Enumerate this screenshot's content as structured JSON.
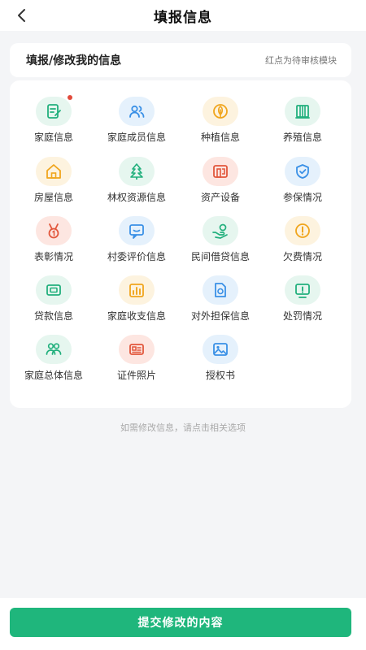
{
  "header": {
    "title": "填报信息",
    "back_icon": "chevron-left-icon"
  },
  "section": {
    "title": "填报/修改我的信息",
    "note": "红点为待审核模块"
  },
  "items": [
    {
      "label": "家庭信息",
      "icon": "edit-document-icon",
      "color": "#22b07d",
      "bg": "#e6f6ef",
      "badge": true
    },
    {
      "label": "家庭成员信息",
      "icon": "users-icon",
      "color": "#3a90e6",
      "bg": "#e5f1fc",
      "badge": false
    },
    {
      "label": "种植信息",
      "icon": "leaf-icon",
      "color": "#f0a51c",
      "bg": "#fdf3df",
      "badge": false
    },
    {
      "label": "养殖信息",
      "icon": "pen-icon",
      "color": "#22b07d",
      "bg": "#e6f6ef",
      "badge": false
    },
    {
      "label": "房屋信息",
      "icon": "house-icon",
      "color": "#f0a51c",
      "bg": "#fdf3df",
      "badge": false
    },
    {
      "label": "林权资源信息",
      "icon": "tree-icon",
      "color": "#22b07d",
      "bg": "#e6f6ef",
      "badge": false
    },
    {
      "label": "资产设备",
      "icon": "asset-icon",
      "color": "#e2573c",
      "bg": "#fde6e1",
      "badge": false
    },
    {
      "label": "参保情况",
      "icon": "shield-icon",
      "color": "#3a90e6",
      "bg": "#e5f1fc",
      "badge": false
    },
    {
      "label": "表彰情况",
      "icon": "medal-icon",
      "color": "#e2573c",
      "bg": "#fde6e1",
      "badge": false
    },
    {
      "label": "村委评价信息",
      "icon": "comment-icon",
      "color": "#3a90e6",
      "bg": "#e5f1fc",
      "badge": false
    },
    {
      "label": "民间借贷信息",
      "icon": "hand-coin-icon",
      "color": "#22b07d",
      "bg": "#e6f6ef",
      "badge": false
    },
    {
      "label": "欠费情况",
      "icon": "alert-circle-icon",
      "color": "#f0a51c",
      "bg": "#fdf3df",
      "badge": false
    },
    {
      "label": "贷款信息",
      "icon": "wallet-icon",
      "color": "#22b07d",
      "bg": "#e6f6ef",
      "badge": false
    },
    {
      "label": "家庭收支信息",
      "icon": "bar-chart-icon",
      "color": "#f0a51c",
      "bg": "#fdf3df",
      "badge": false
    },
    {
      "label": "对外担保信息",
      "icon": "guarantee-doc-icon",
      "color": "#3a90e6",
      "bg": "#e5f1fc",
      "badge": false
    },
    {
      "label": "处罚情况",
      "icon": "warning-board-icon",
      "color": "#22b07d",
      "bg": "#e6f6ef",
      "badge": false
    },
    {
      "label": "家庭总体信息",
      "icon": "family-icon",
      "color": "#22b07d",
      "bg": "#e6f6ef",
      "badge": false
    },
    {
      "label": "证件照片",
      "icon": "id-card-icon",
      "color": "#e2573c",
      "bg": "#fde6e1",
      "badge": false
    },
    {
      "label": "授权书",
      "icon": "image-icon",
      "color": "#3a90e6",
      "bg": "#e5f1fc",
      "badge": false
    }
  ],
  "hint": "如需修改信息，请点击相关选项",
  "footer": {
    "submit_label": "提交修改的内容"
  }
}
